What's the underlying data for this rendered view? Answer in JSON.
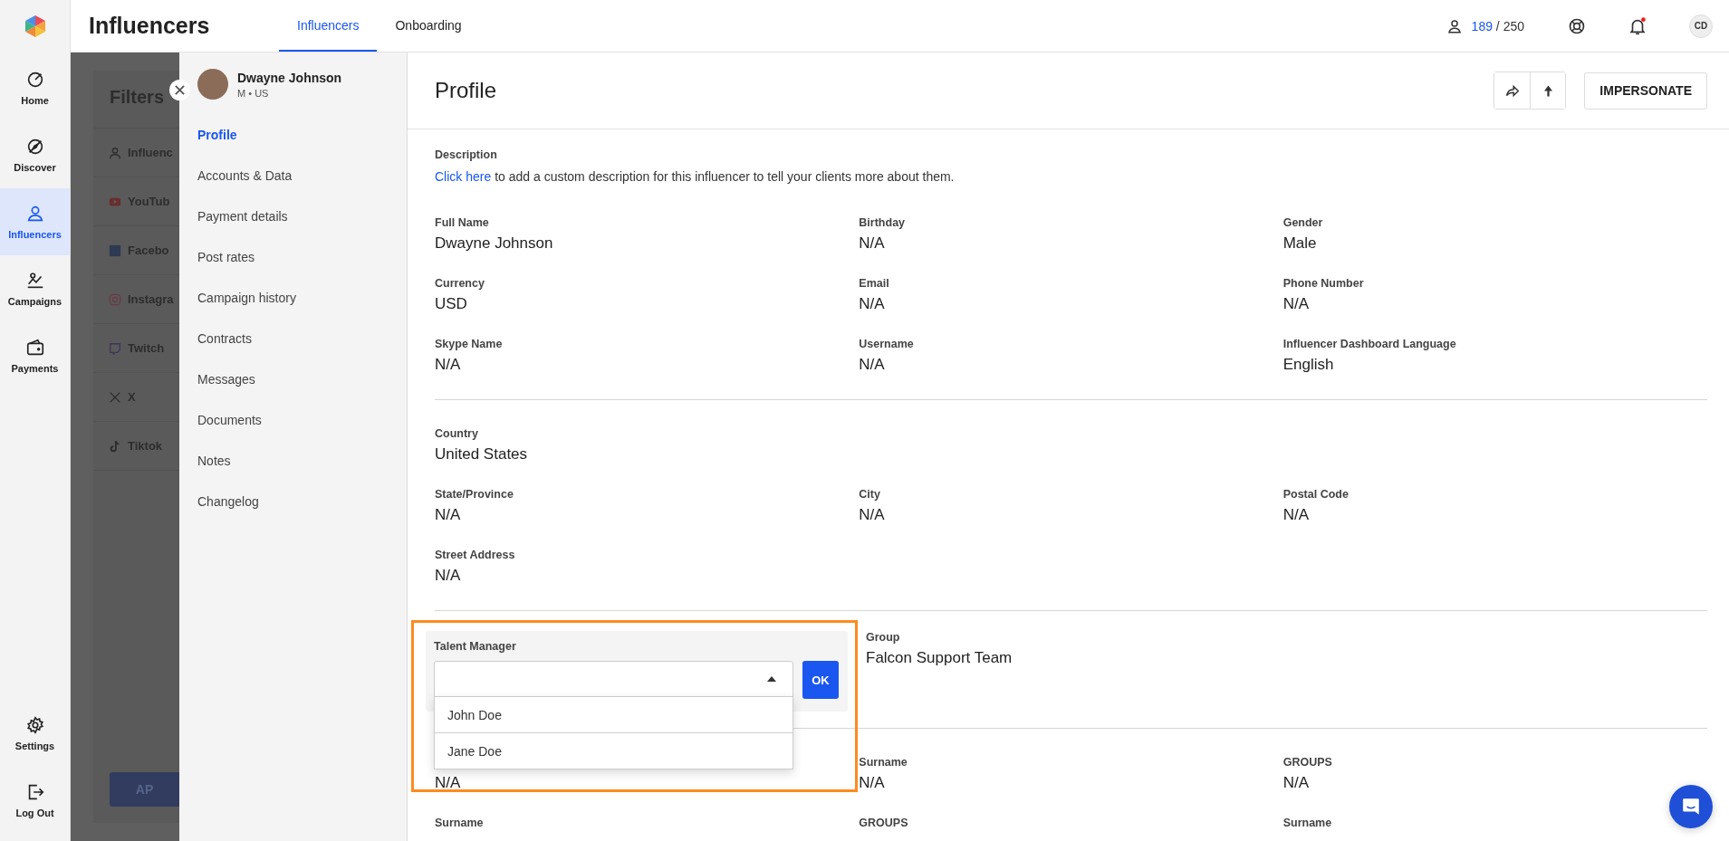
{
  "nav": {
    "items": [
      {
        "label": "Home",
        "selected": false
      },
      {
        "label": "Discover",
        "selected": false
      },
      {
        "label": "Influencers",
        "selected": true
      },
      {
        "label": "Campaigns",
        "selected": false
      },
      {
        "label": "Payments",
        "selected": false
      }
    ],
    "bottom_items": [
      {
        "label": "Settings"
      },
      {
        "label": "Log Out"
      }
    ]
  },
  "header": {
    "title": "Influencers",
    "tabs": [
      {
        "label": "Influencers",
        "selected": true
      },
      {
        "label": "Onboarding",
        "selected": false
      }
    ],
    "usage": {
      "used": "189",
      "total": "/ 250"
    },
    "notifications": {
      "unread": true
    },
    "avatar": "CD"
  },
  "filters": {
    "title": "Filters",
    "items": [
      "Influenc",
      "YouTub",
      "Facebo",
      "Instagra",
      "Twitch",
      "X",
      "Tiktok"
    ],
    "button": "AP"
  },
  "drawer": {
    "name": "Dwayne Johnson",
    "meta": "M • US",
    "menu": [
      {
        "label": "Profile",
        "selected": true
      },
      {
        "label": "Accounts & Data",
        "selected": false
      },
      {
        "label": "Payment details",
        "selected": false
      },
      {
        "label": "Post rates",
        "selected": false
      },
      {
        "label": "Campaign history",
        "selected": false
      },
      {
        "label": "Contracts",
        "selected": false
      },
      {
        "label": "Messages",
        "selected": false
      },
      {
        "label": "Documents",
        "selected": false
      },
      {
        "label": "Notes",
        "selected": false
      },
      {
        "label": "Changelog",
        "selected": false
      }
    ]
  },
  "profile": {
    "title": "Profile",
    "action": "IMPERSONATE",
    "description": {
      "label": "Description",
      "link": "Click here",
      "text": " to add a custom description for this influencer to tell your clients more about them."
    },
    "sections": [
      {
        "kind": "fields",
        "rows": [
          [
            {
              "label": "Full Name",
              "value": "Dwayne Johnson"
            },
            {
              "label": "Birthday",
              "value": "N/A"
            },
            {
              "label": "Gender",
              "value": "Male"
            }
          ],
          [
            {
              "label": "Currency",
              "value": "USD"
            },
            {
              "label": "Email",
              "value": "N/A"
            },
            {
              "label": "Phone Number",
              "value": "N/A"
            }
          ],
          [
            {
              "label": "Skype Name",
              "value": "N/A"
            },
            {
              "label": "Username",
              "value": "N/A"
            },
            {
              "label": "Influencer Dashboard Language",
              "value": "English"
            }
          ]
        ]
      },
      {
        "kind": "fields",
        "rows": [
          [
            {
              "label": "Country",
              "value": "United States"
            }
          ],
          [
            {
              "label": "State/Province",
              "value": "N/A"
            },
            {
              "label": "City",
              "value": "N/A"
            },
            {
              "label": "Postal Code",
              "value": "N/A"
            }
          ],
          [
            {
              "label": "Street Address",
              "value": "N/A"
            }
          ]
        ]
      },
      {
        "kind": "talent",
        "label": "Talent Manager",
        "button": "OK",
        "expanded": true,
        "options": [
          {
            "label": "John Doe"
          },
          {
            "label": "Jane Doe"
          }
        ],
        "fields": [
          {
            "label": "Group",
            "value": "Falcon Support Team"
          }
        ]
      },
      {
        "kind": "fields",
        "rows": [
          [
            {
              "value": "N/A"
            },
            {
              "label": "Surname",
              "value": "N/A"
            },
            {
              "label": "GROUPS",
              "value": "N/A"
            }
          ],
          [
            {
              "label": "Surname"
            },
            {
              "label": "GROUPS"
            },
            {
              "label": "Surname"
            }
          ]
        ]
      }
    ]
  }
}
